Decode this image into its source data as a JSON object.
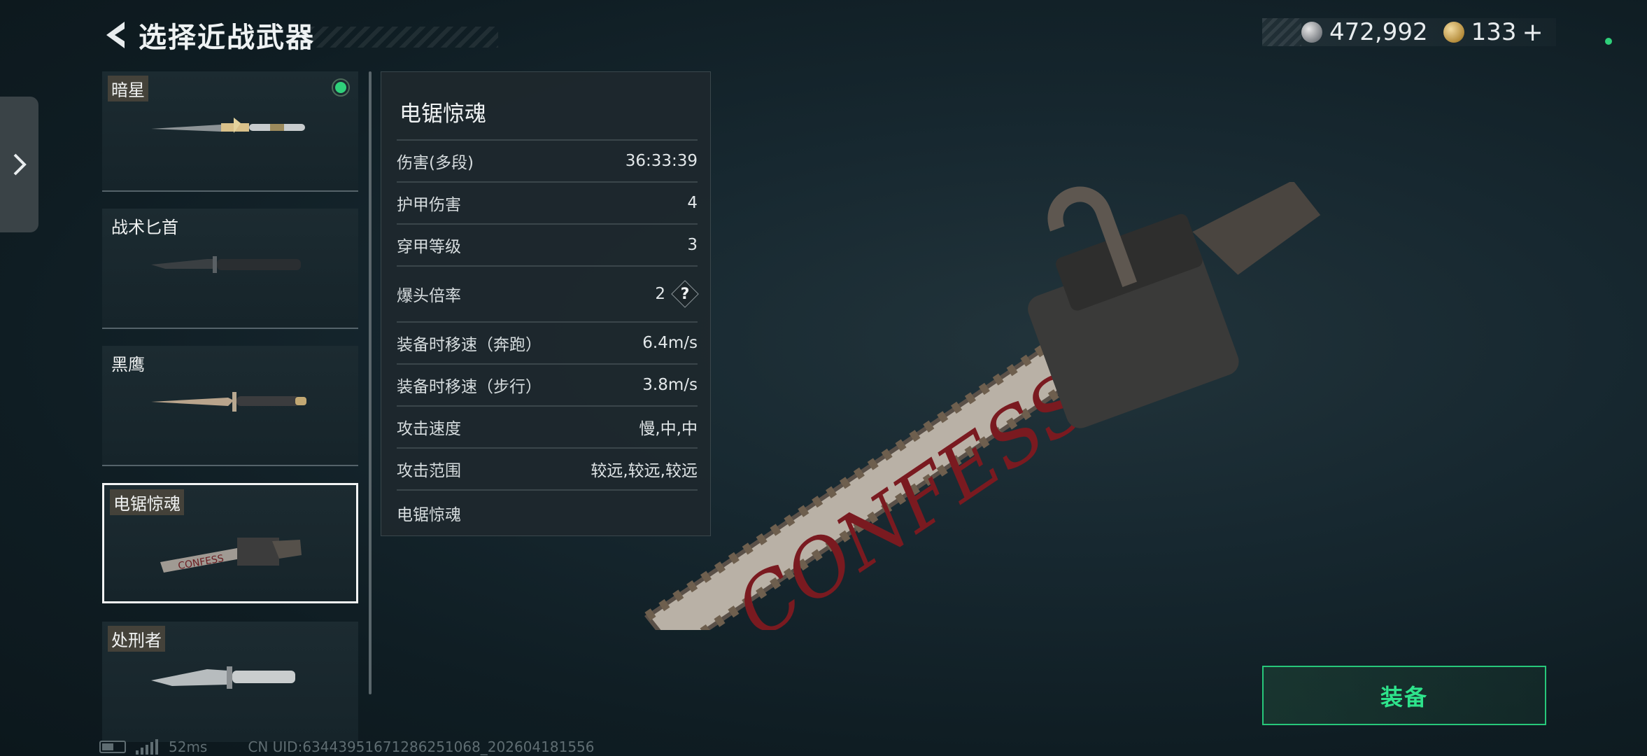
{
  "header": {
    "title": "选择近战武器",
    "back_icon": "back-arrow-icon"
  },
  "currency": [
    {
      "icon": "silver-coin-icon",
      "value": "472,992"
    },
    {
      "icon": "gold-coin-icon",
      "value": "133"
    }
  ],
  "currency_plus": "+",
  "weapons": [
    {
      "name": "暗星",
      "equipped": true
    },
    {
      "name": "战术匕首"
    },
    {
      "name": "黑鹰"
    },
    {
      "name": "电锯惊魂",
      "selected": true
    },
    {
      "name": "处刑者"
    }
  ],
  "detail": {
    "title": "电锯惊魂",
    "stats": [
      {
        "label": "伤害(多段)",
        "value": "36:33:39"
      },
      {
        "label": "护甲伤害",
        "value": "4"
      },
      {
        "label": "穿甲等级",
        "value": "3"
      },
      {
        "label": "爆头倍率",
        "value": "2"
      },
      {
        "label": "装备时移速（奔跑）",
        "value": "6.4m/s"
      },
      {
        "label": "装备时移速（步行）",
        "value": "3.8m/s"
      },
      {
        "label": "攻击速度",
        "value": "慢,中,中"
      },
      {
        "label": "攻击范围",
        "value": "较远,较远,较远"
      }
    ],
    "footer_name": "电锯惊魂",
    "help_glyph": "?"
  },
  "equip_button": {
    "label": "装备"
  },
  "footer": {
    "ping": "52ms",
    "uid": "CN UID:63443951671286251068_202604181556"
  },
  "colors": {
    "accent_green": "#2ee38b",
    "background": "#13232a"
  }
}
